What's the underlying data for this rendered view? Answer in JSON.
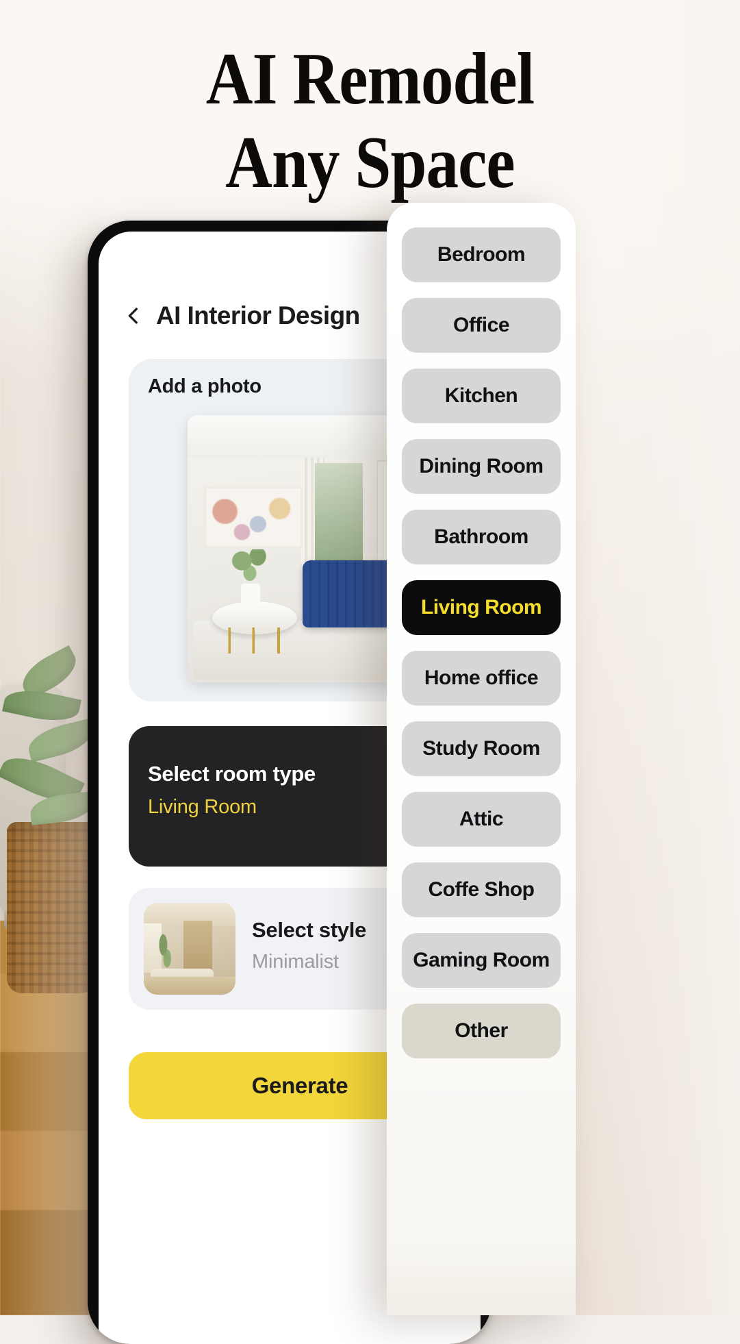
{
  "headline": {
    "line1": "AI Remodel",
    "line2": "Any Space"
  },
  "phone": {
    "nav": {
      "back_icon": "chevron-left-icon",
      "title": "AI Interior Design"
    },
    "photo_card": {
      "label": "Add a photo"
    },
    "room_type_card": {
      "title": "Select room type",
      "value": "Living Room"
    },
    "style_card": {
      "title": "Select style",
      "value": "Minimalist"
    },
    "generate_button": {
      "label": "Generate"
    }
  },
  "room_panel": {
    "items": [
      {
        "label": "Bedroom",
        "state": "default"
      },
      {
        "label": "Office",
        "state": "default"
      },
      {
        "label": "Kitchen",
        "state": "default"
      },
      {
        "label": "Dining Room",
        "state": "default"
      },
      {
        "label": "Bathroom",
        "state": "default"
      },
      {
        "label": "Living Room",
        "state": "selected"
      },
      {
        "label": "Home office",
        "state": "default"
      },
      {
        "label": "Study Room",
        "state": "default"
      },
      {
        "label": "Attic",
        "state": "default"
      },
      {
        "label": "Coffe Shop",
        "state": "default"
      },
      {
        "label": "Gaming Room",
        "state": "default"
      },
      {
        "label": "Other",
        "state": "dim"
      }
    ]
  },
  "colors": {
    "accent_yellow": "#f2d63a",
    "selected_text_yellow": "#f5dd2b",
    "dark_card": "#232325",
    "pill_grey": "#d5d6d8",
    "page_background": "#faf6f2"
  }
}
